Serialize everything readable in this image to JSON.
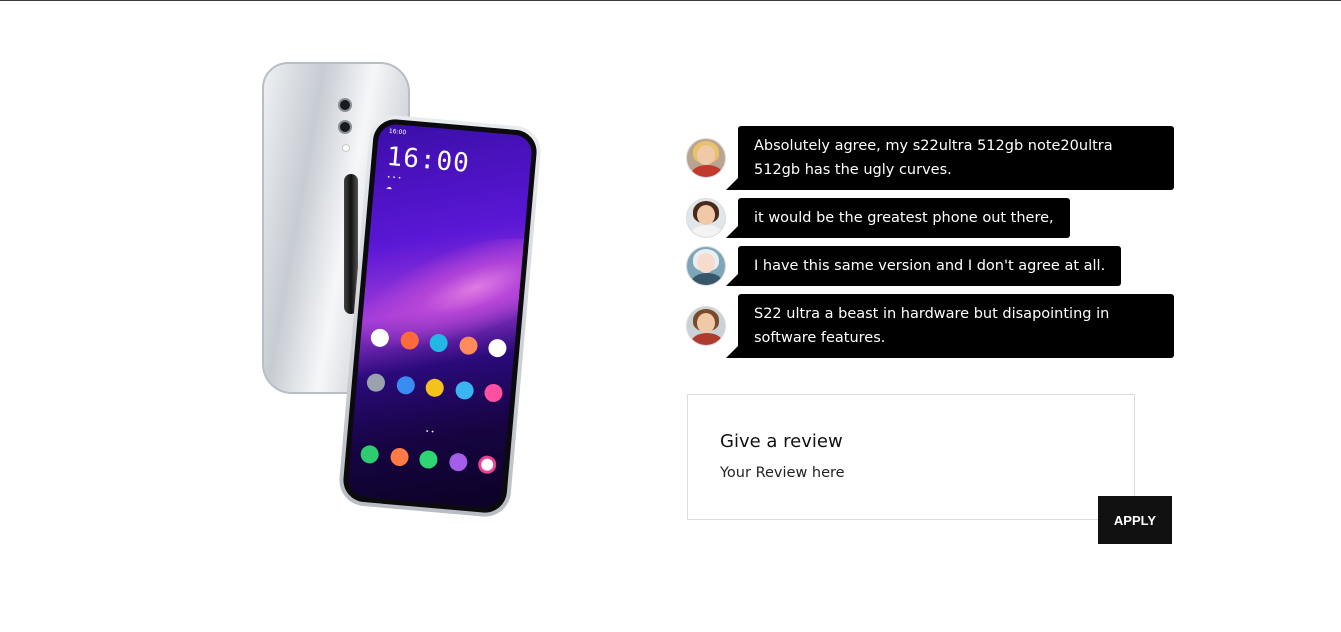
{
  "product": {
    "image_alt": "smartphone-product-image",
    "screen_time": "16:00",
    "status_time": "16:00"
  },
  "comments": [
    {
      "avatar": "avatar-blonde-woman",
      "text": "Absolutely agree, my s22ultra 512gb note20ultra 512gb has the ugly curves."
    },
    {
      "avatar": "avatar-dark-hair-woman",
      "text": "it would be the greatest phone out there,"
    },
    {
      "avatar": "avatar-silver-hair-person",
      "text": "I have this same version and I don't agree at all."
    },
    {
      "avatar": "avatar-man-glasses",
      "text": "S22 ultra a beast in hardware but disapointing in software features."
    }
  ],
  "review": {
    "title": "Give a review",
    "placeholder": "Your Review here",
    "apply_label": "APPLY"
  },
  "colors": {
    "bubble_bg": "#000000",
    "button_bg": "#111111",
    "border": "#dddddd"
  }
}
